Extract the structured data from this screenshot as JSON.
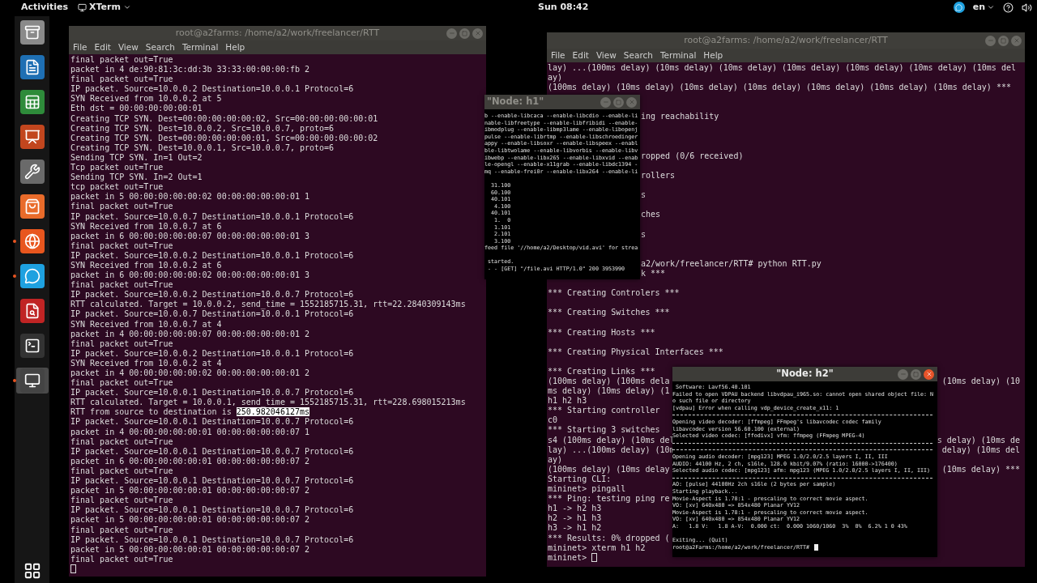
{
  "top_bar": {
    "activities": "Activities",
    "app_menu": "XTerm",
    "clock": "Sun 08:42",
    "language": "en"
  },
  "dock": {
    "items": [
      {
        "selected": false,
        "running": false
      },
      {
        "selected": false,
        "running": false
      },
      {
        "selected": false,
        "running": false
      },
      {
        "selected": false,
        "running": false
      },
      {
        "selected": false,
        "running": false
      },
      {
        "selected": false,
        "running": false
      },
      {
        "selected": false,
        "running": true
      },
      {
        "selected": false,
        "running": true
      },
      {
        "selected": false,
        "running": false
      },
      {
        "selected": false,
        "running": false
      },
      {
        "selected": true,
        "running": true
      }
    ]
  },
  "windows": [
    {
      "title": "root@a2farms: /home/a2/work/freelancer/RTT",
      "focused": false,
      "menu": [
        "File",
        "Edit",
        "View",
        "Search",
        "Terminal",
        "Help"
      ],
      "lines": [
        {
          "text": "final packet out=True"
        },
        {
          "text": "packet in 4 de:90:81:3c:dd:3b 33:33:00:00:00:fb 2"
        },
        {
          "text": "final packet out=True"
        },
        {
          "text": "IP packet. Source=10.0.0.2 Destination=10.0.0.1 Protocol=6"
        },
        {
          "text": "SYN Received from 10.0.0.2 at 5"
        },
        {
          "text": "Eth dst = 00:00:00:00:00:01"
        },
        {
          "text": "Creating TCP SYN. Dest=00:00:00:00:00:02, Src=00:00:00:00:00:01"
        },
        {
          "text": "Creating TCP SYN. Dest=10.0.0.2, Src=10.0.0.7, proto=6"
        },
        {
          "text": "Creating TCP SYN. Dest=00:00:00:00:00:01, Src=00:00:00:00:00:02"
        },
        {
          "text": "Creating TCP SYN. Dest=10.0.0.1, Src=10.0.0.7, proto=6"
        },
        {
          "text": "Sending TCP SYN. In=1 Out=2"
        },
        {
          "text": "Tcp packet out=True"
        },
        {
          "text": "Sending TCP SYN. In=2 Out=1"
        },
        {
          "text": "tcp packet out=True"
        },
        {
          "text": "packet in 5 00:00:00:00:00:02 00:00:00:00:00:01 1"
        },
        {
          "text": "final packet out=True"
        },
        {
          "text": "IP packet. Source=10.0.0.7 Destination=10.0.0.1 Protocol=6"
        },
        {
          "text": "SYN Received from 10.0.0.7 at 6"
        },
        {
          "text": "packet in 6 00:00:00:00:00:07 00:00:00:00:00:01 3"
        },
        {
          "text": "final packet out=True"
        },
        {
          "text": "IP packet. Source=10.0.0.2 Destination=10.0.0.1 Protocol=6"
        },
        {
          "text": "SYN Received from 10.0.0.2 at 6"
        },
        {
          "text": "packet in 6 00:00:00:00:00:02 00:00:00:00:00:01 3"
        },
        {
          "text": "final packet out=True"
        },
        {
          "text": "IP packet. Source=10.0.0.2 Destination=10.0.0.7 Protocol=6"
        },
        {
          "text": "RTT calculated. Target = 10.0.0.2, send_time = 1552185715.31, rtt=22.2840309143ms"
        },
        {
          "text": "IP packet. Source=10.0.0.7 Destination=10.0.0.1 Protocol=6"
        },
        {
          "text": "SYN Received from 10.0.0.7 at 4"
        },
        {
          "text": "packet in 4 00:00:00:00:00:07 00:00:00:00:00:01 2"
        },
        {
          "text": "final packet out=True"
        },
        {
          "text": "IP packet. Source=10.0.0.2 Destination=10.0.0.1 Protocol=6"
        },
        {
          "text": "SYN Received from 10.0.0.2 at 4"
        },
        {
          "text": "packet in 4 00:00:00:00:00:02 00:00:00:00:00:01 2"
        },
        {
          "text": "final packet out=True"
        },
        {
          "text": "IP packet. Source=10.0.0.1 Destination=10.0.0.7 Protocol=6"
        },
        {
          "text": "RTT calculated. Target = 10.0.0.1, send_time = 1552185715.31, rtt=228.698015213ms"
        },
        {
          "text": "RTT from source to destination is ",
          "selected_text": "250.982046127ms"
        },
        {
          "text": "IP packet. Source=10.0.0.1 Destination=10.0.0.7 Protocol=6"
        },
        {
          "text": "packet in 4 00:00:00:00:00:01 00:00:00:00:00:07 1"
        },
        {
          "text": "final packet out=True"
        },
        {
          "text": "IP packet. Source=10.0.0.1 Destination=10.0.0.7 Protocol=6"
        },
        {
          "text": "packet in 6 00:00:00:00:00:01 00:00:00:00:00:07 2"
        },
        {
          "text": "final packet out=True"
        },
        {
          "text": "IP packet. Source=10.0.0.1 Destination=10.0.0.7 Protocol=6"
        },
        {
          "text": "packet in 5 00:00:00:00:00:01 00:00:00:00:00:07 2"
        },
        {
          "text": "final packet out=True"
        },
        {
          "text": "IP packet. Source=10.0.0.1 Destination=10.0.0.7 Protocol=6"
        },
        {
          "text": "packet in 5 00:00:00:00:00:01 00:00:00:00:00:07 2"
        },
        {
          "text": "final packet out=True"
        },
        {
          "text": "IP packet. Source=10.0.0.1 Destination=10.0.0.7 Protocol=6"
        },
        {
          "text": "packet in 5 00:00:00:00:00:01 00:00:00:00:00:07 2"
        },
        {
          "text": "final packet out=True"
        },
        {
          "kind": "cursor"
        }
      ]
    },
    {
      "title": "root@a2farms: /home/a2/work/freelancer/RTT",
      "focused": false,
      "menu": [
        "File",
        "Edit",
        "View",
        "Search",
        "Terminal",
        "Help"
      ],
      "lines": [
        {
          "text": "lay) ...(100ms delay) (10ms delay) (10ms delay) (10ms delay) (10ms delay) (10ms delay) (10ms del"
        },
        {
          "text": "ay)"
        },
        {
          "text": "(100ms delay) (10ms delay) (10ms delay) (10ms delay) (10ms delay) (10ms delay) (10ms delay) ***"
        },
        {
          "kind": "blank"
        },
        {
          "kind": "blank"
        },
        {
          "kind": "tail",
          "text": "ing reachability"
        },
        {
          "kind": "blank"
        },
        {
          "kind": "blank"
        },
        {
          "kind": "blank"
        },
        {
          "kind": "tail",
          "text": "ropped (0/6 received)"
        },
        {
          "kind": "blank"
        },
        {
          "kind": "tail",
          "text": "rollers"
        },
        {
          "kind": "blank"
        },
        {
          "kind": "tail",
          "text": "s"
        },
        {
          "kind": "blank"
        },
        {
          "kind": "tail",
          "text": "ches"
        },
        {
          "kind": "blank"
        },
        {
          "kind": "tail",
          "text": "s"
        },
        {
          "kind": "blank"
        },
        {
          "kind": "blank"
        },
        {
          "kind": "tail",
          "text": "a2/work/freelancer/RTT# python RTT.py"
        },
        {
          "kind": "tail",
          "text": "k ***"
        },
        {
          "kind": "blank"
        },
        {
          "text": "*** Creating Controlers ***"
        },
        {
          "kind": "blank"
        },
        {
          "text": "*** Creating Switches ***"
        },
        {
          "kind": "blank"
        },
        {
          "text": "*** Creating Hosts ***"
        },
        {
          "kind": "blank"
        },
        {
          "text": "*** Creating Physical Interfaces ***"
        },
        {
          "kind": "blank"
        },
        {
          "text": "*** Creating Links ***"
        },
        {
          "kind": "split",
          "text": "(100ms delay) (100ms dela",
          "text_right": "(10ms delay) (10"
        },
        {
          "text": "ms delay) (10ms delay) (1"
        },
        {
          "text": "h1 h2 h3"
        },
        {
          "text": "*** Starting controller"
        },
        {
          "text": "c0"
        },
        {
          "text": "*** Starting 3 switches"
        },
        {
          "kind": "split",
          "text": "s4 (100ms delay) (10ms del",
          "text_right": "s delay) (10ms de"
        },
        {
          "kind": "split",
          "text": "lay) ...(100ms delay) (10m",
          "text_right": "delay) (10ms del"
        },
        {
          "text": "ay)"
        },
        {
          "kind": "split",
          "text": "(100ms delay) (10ms delay",
          "text_right": "(10ms delay) ***"
        },
        {
          "text": "Starting CLI:"
        },
        {
          "text": "mininet> pingall"
        },
        {
          "text": "*** Ping: testing ping re"
        },
        {
          "text": "h1 -> h2 h3"
        },
        {
          "text": "h2 -> h1 h3"
        },
        {
          "text": "h3 -> h1 h2"
        },
        {
          "text": "*** Results: 0% dropped ("
        },
        {
          "text": "mininet> xterm h1 h2"
        },
        {
          "kind": "cursor",
          "text": "mininet>"
        }
      ]
    },
    {
      "title": "\"Node: h1\"",
      "focused": false,
      "lines": [
        {
          "text": "b --enable-libcaca --enable-libcdio --enable-li"
        },
        {
          "text": "nable-libfreetype --enable-libfribidi --enable-"
        },
        {
          "text": "ibmodplug --enable-libmp3lame --enable-libopenj"
        },
        {
          "text": "pulse --enable-librtmp --enable-libschroedinger"
        },
        {
          "text": "appy --enable-libsoxr --enable-libspeex --enabl"
        },
        {
          "text": "ble-libtwolame --enable-libvorbis --enable-libv"
        },
        {
          "text": "ibwebp --enable-libx265 --enable-libxvid --enab"
        },
        {
          "text": "le-opengl --enable-x11grab --enable-libdc1394 -"
        },
        {
          "text": "mq --enable-frei0r --enable-libx264 --enable-li"
        },
        {
          "kind": "blank"
        },
        {
          "text": "  31.100"
        },
        {
          "text": "  60.100"
        },
        {
          "text": "  40.101"
        },
        {
          "text": "   4.100"
        },
        {
          "text": "  40.101"
        },
        {
          "text": "   1.  0"
        },
        {
          "text": "   1.101"
        },
        {
          "text": "   2.101"
        },
        {
          "text": "   3.100"
        },
        {
          "text": "feed file '//home/a2/Desktop/vid.avi' for strea"
        },
        {
          "kind": "blank"
        },
        {
          "text": " started."
        },
        {
          "text": " - - [GET] \"/file.avi HTTP/1.0\" 200 3953990"
        }
      ]
    },
    {
      "title": "\"Node: h2\"",
      "focused": true,
      "lines": [
        {
          "text": " Software: Lavf56.40.101"
        },
        {
          "text": "Failed to open VDPAU backend libvdpau_i965.so: cannot open shared object file: N"
        },
        {
          "text": "o such file or directory"
        },
        {
          "text": "[vdpau] Error when calling vdp_device_create_x11: 1"
        },
        {
          "kind": "rule"
        },
        {
          "text": "Opening video decoder: [ffmpeg] FFmpeg's libavcodec codec family"
        },
        {
          "text": "libavcodec version 56.60.100 (external)"
        },
        {
          "text": "Selected video codec: [ffodivx] vfm: ffmpeg (FFmpeg MPEG-4)"
        },
        {
          "kind": "rule"
        },
        {
          "kind": "rule"
        },
        {
          "text": "Opening audio decoder: [mpg123] MPEG 1.0/2.0/2.5 layers I, II, III"
        },
        {
          "text": "AUDIO: 44100 Hz, 2 ch, s16le, 128.0 kbit/9.07% (ratio: 16000->176400)"
        },
        {
          "text": "Selected audio codec: [mpg123] afm: mpg123 (MPEG 1.0/2.0/2.5 layers I, II, III)"
        },
        {
          "kind": "rule"
        },
        {
          "text": "AO: [pulse] 44100Hz 2ch s16le (2 bytes per sample)"
        },
        {
          "text": "Starting playback..."
        },
        {
          "text": "Movie-Aspect is 1.78:1 - prescaling to correct movie aspect."
        },
        {
          "text": "VO: [xv] 640x480 => 854x480 Planar YV12"
        },
        {
          "text": "Movie-Aspect is 1.78:1 - prescaling to correct movie aspect."
        },
        {
          "text": "VO: [xv] 640x480 => 854x480 Planar YV12"
        },
        {
          "text": "A:   1.8 V:   1.8 A-V:  0.000 ct:  0.000 1060/1060  3%  0%  6.2% 1 0 43%"
        },
        {
          "kind": "blank"
        },
        {
          "text": "Exiting... (Quit)"
        },
        {
          "kind": "cursor",
          "text": "root@a2Farms:/home/a2/work/freelancer/RTT#"
        }
      ]
    }
  ]
}
